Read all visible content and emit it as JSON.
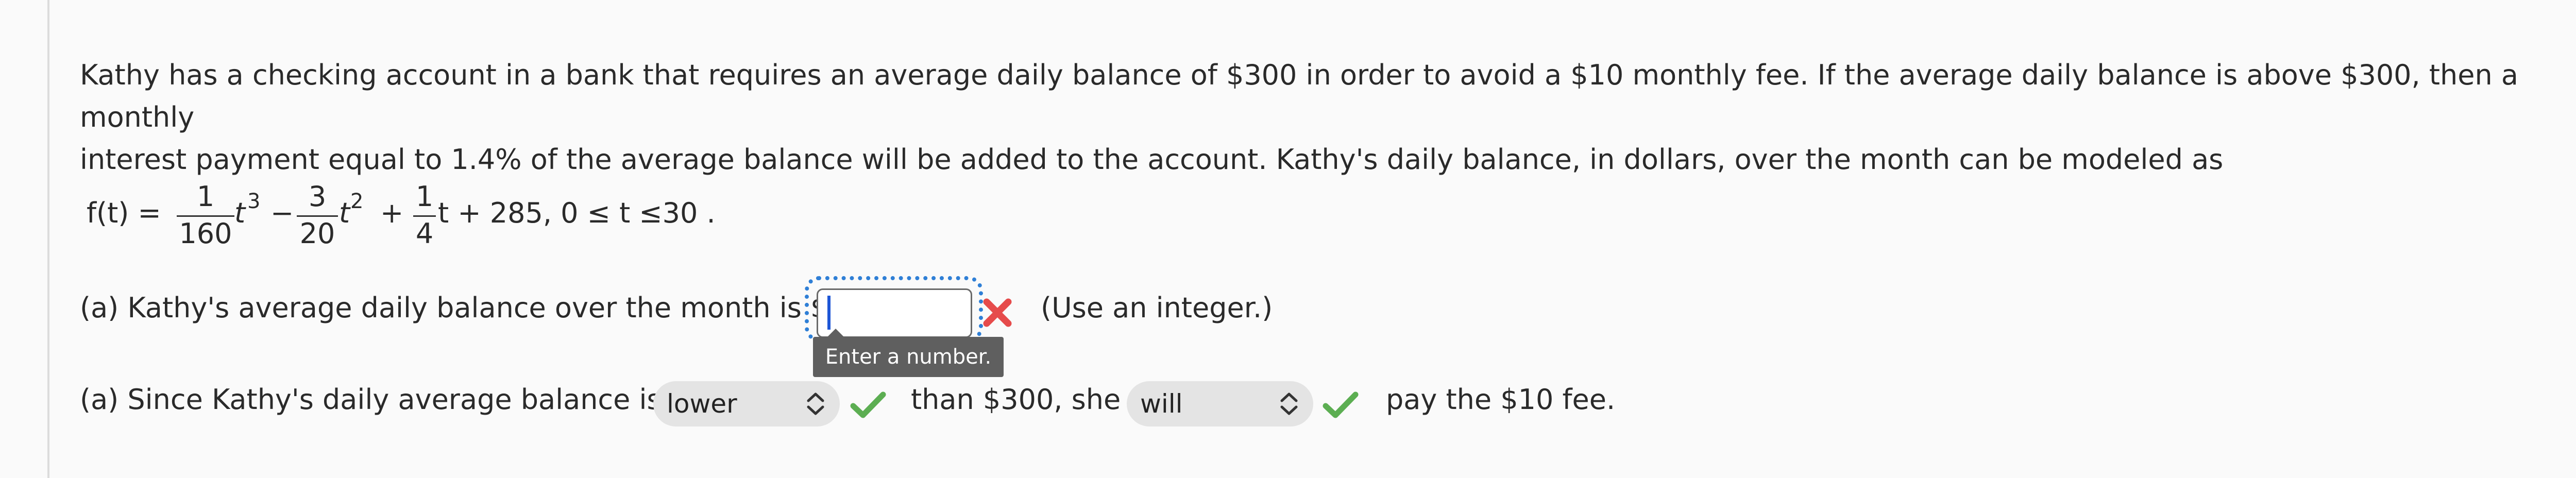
{
  "problem": {
    "line1": "Kathy has a checking account in a bank that requires an average daily balance of $300 in order to avoid a $10 monthly fee. If the average daily balance is above $300, then a monthly",
    "line2": "interest payment equal to 1.4% of the average balance will be added to the account. Kathy's daily balance, in dollars, over the month can be modeled as"
  },
  "formula": {
    "lhs": "f(t) =",
    "frac1": {
      "num": "1",
      "den": "160"
    },
    "t3": "t",
    "exp3": "3",
    "minus": "−",
    "frac2": {
      "num": "3",
      "den": "20"
    },
    "t2": "t",
    "exp2": "2",
    "plus": "+",
    "frac3": {
      "num": "1",
      "den": "4"
    },
    "tail": "t + 285, 0 ≤ t ≤30 ."
  },
  "part_a": {
    "prefix": "(a) Kathy's average daily balance over the month is $",
    "input_value": "",
    "hint": "(Use an integer.)",
    "tooltip": "Enter a number.",
    "status_icon": "x-icon",
    "status_color": "#e64b4b"
  },
  "part_b": {
    "prefix": "(a) Since Kathy's daily average balance is",
    "select1_value": "lower",
    "middle": "than $300, she",
    "select2_value": "will",
    "suffix": "pay the $10 fee.",
    "check_color": "#5cae52"
  },
  "colors": {
    "focus_ring": "#2f7fd6",
    "caret": "#1e56d6",
    "tooltip_bg": "#5f5f5f",
    "select_bg": "#e4e4e4"
  }
}
